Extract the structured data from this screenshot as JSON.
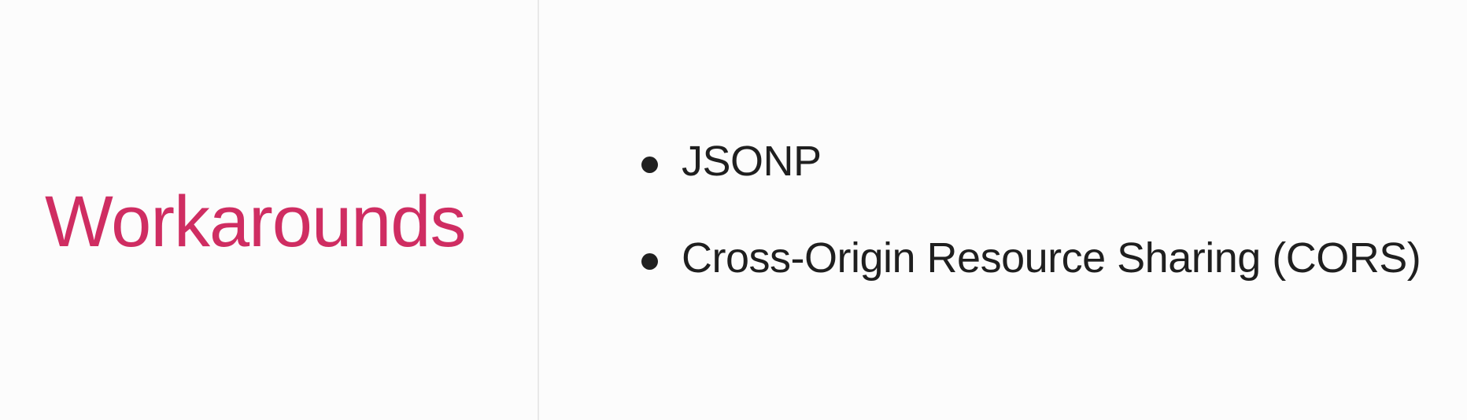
{
  "slide": {
    "title": "Workarounds",
    "bullets": [
      {
        "text": "JSONP"
      },
      {
        "text": "Cross-Origin Resource Sharing (CORS)"
      }
    ]
  },
  "colors": {
    "title": "#cf2d62",
    "text": "#1f1f1f",
    "background": "#fcfcfc",
    "divider": "#e8e8e8"
  }
}
